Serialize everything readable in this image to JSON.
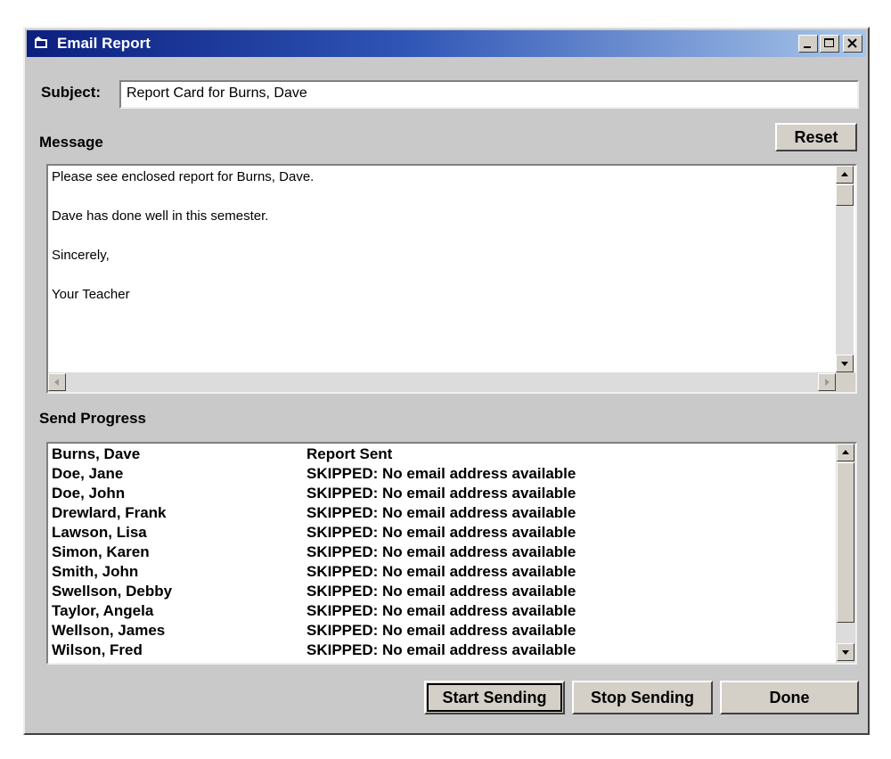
{
  "window": {
    "title": "Email Report",
    "icon": "report-app-icon"
  },
  "subject": {
    "label": "Subject:",
    "value": "Report Card for Burns, Dave"
  },
  "message": {
    "label": "Message",
    "reset_label": "Reset",
    "lines": [
      "Please see enclosed report for Burns, Dave.",
      "Dave has done well in this semester.",
      "Sincerely,",
      "Your Teacher"
    ]
  },
  "progress": {
    "label": "Send Progress",
    "rows": [
      {
        "name": "Burns, Dave",
        "status": "Report Sent"
      },
      {
        "name": "Doe, Jane",
        "status": "SKIPPED: No email address available"
      },
      {
        "name": "Doe, John",
        "status": "SKIPPED: No email address available"
      },
      {
        "name": "Drewlard, Frank",
        "status": "SKIPPED: No email address available"
      },
      {
        "name": "Lawson, Lisa",
        "status": "SKIPPED: No email address available"
      },
      {
        "name": "Simon, Karen",
        "status": "SKIPPED: No email address available"
      },
      {
        "name": "Smith, John",
        "status": "SKIPPED: No email address available"
      },
      {
        "name": "Swellson, Debby",
        "status": "SKIPPED: No email address available"
      },
      {
        "name": "Taylor, Angela",
        "status": "SKIPPED: No email address available"
      },
      {
        "name": "Wellson, James",
        "status": "SKIPPED: No email address available"
      },
      {
        "name": "Wilson, Fred",
        "status": "SKIPPED: No email address available"
      }
    ]
  },
  "buttons": {
    "start": "Start Sending",
    "stop": "Stop Sending",
    "done": "Done"
  }
}
